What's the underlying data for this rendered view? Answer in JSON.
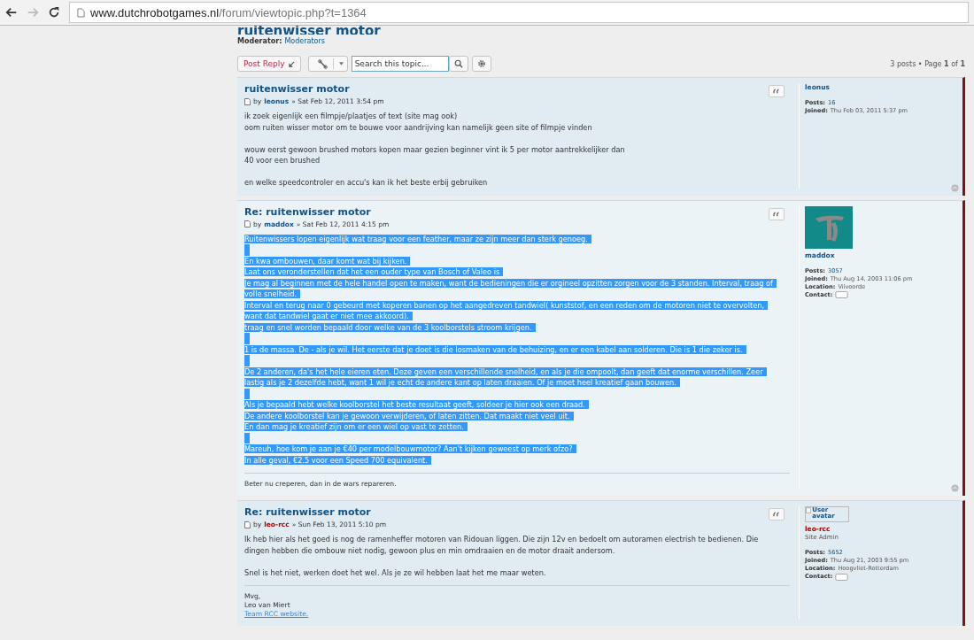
{
  "browser": {
    "url_host": "www.dutchrobotgames.nl",
    "url_path": "/forum/viewtopic.php?t=1364"
  },
  "topic": {
    "title": "ruitenwisser motor",
    "moderator_label": "Moderator:",
    "moderator": "Moderators"
  },
  "toolbar": {
    "post_reply": "Post Reply",
    "search_placeholder": "Search this topic...",
    "pagination": {
      "posts": "3 posts • Page",
      "current": "1",
      "of": "of",
      "total": "1"
    }
  },
  "posts": [
    {
      "title": "ruitenwisser motor",
      "by": "by",
      "author": "leonus",
      "color": "#105289",
      "date": "» Sat Feb 12, 2011 3:54 pm",
      "selected": false,
      "paragraphs": [
        [
          "ik zoek eigenlijk een filmpje/plaatjes of text (site mag ook)",
          "oom ruiten wisser motor om te bouwe voor aandrijving kan namelijk geen site of filmpje vinden"
        ],
        [
          "wouw eerst gewoon brushed motors kopen maar gezien beginner vint ik 5 per motor aantrekkelijker dan",
          "40 voor een brushed"
        ],
        [
          "en welke speedcontroler en accu's kan ik het beste erbij gebruiken"
        ]
      ],
      "profile": {
        "username": "leonus",
        "fields": [
          {
            "label": "Posts:",
            "value": "16",
            "kind": "link"
          },
          {
            "label": "Joined:",
            "value": "Thu Feb 03, 2011 5:37 pm",
            "kind": "text"
          }
        ]
      }
    },
    {
      "title": "Re: ruitenwisser motor",
      "by": "by",
      "author": "maddox",
      "color": "#105289",
      "date": "» Sat Feb 12, 2011 4:15 pm",
      "selected": true,
      "paragraphs": [
        [
          "Ruitenwissers lopen eigenlijk wat traag voor een feather, maar ze zijn meer dan sterk genoeg."
        ],
        [
          "En kwa ombouwen, daar komt wat bij kijken.",
          "Laat ons veronderstellen dat het een ouder type van Bosch of Valeo is",
          "Je mag al beginnen met de hele handel open te maken, want de bedieningen die er orgineel opzitten zorgen voor de 3 standen. Interval, traag of",
          "volle snelheid.",
          "Interval en terug naar 0 gebeurd met koperen banen op het aangedreven tandwiel( kunststof, en een reden om de motoren niet te overvolten,",
          "want dat tandwiel gaat er niet mee akkoord).",
          "traag en snel worden bepaald door welke van de 3 koolborstels stroom krijgen."
        ],
        [
          "1 is de massa. De - als je wil. Het eerste dat je doet is die losmaken van de behuizing, en er een kabel aan solderen. Die is 1 die zeker is."
        ],
        [
          "De 2 anderen, da's het hele eieren eten. Deze geven een verschillende snelheid, en als je die ompoolt, dan geeft dat enorme verschillen. Zeer",
          "lastig als je 2 dezelfde hebt, want 1 wil je echt de andere kant op laten draaien. Of je moet heel kreatief gaan bouwen."
        ],
        [
          "Als je bepaald hebt welke koolborstel het beste resultaat geeft, soldeer je hier ook een draad.",
          "De andere koolborstel kan je gewoon verwijderen, of laten zitten. Dat maakt niet veel uit.",
          "En dan mag je kreatief zijn om er een wiel op vast te zetten."
        ],
        [
          "Mareuh, hoe kom je aan je €40 per modelbouwmotor? Aan't kijken geweest op merk ofzo?",
          "In alle geval, €2.5 voor een Speed 700 equivalent."
        ]
      ],
      "signature": [
        "Beter nu creperen, dan in de wars repareren."
      ],
      "profile": {
        "username": "maddox",
        "fields": [
          {
            "label": "Posts:",
            "value": "3057",
            "kind": "link"
          },
          {
            "label": "Joined:",
            "value": "Thu Aug 14, 2003 11:06 pm",
            "kind": "text"
          },
          {
            "label": "Location:",
            "value": "Vilvoorde",
            "kind": "text"
          },
          {
            "label": "Contact:",
            "kind": "contact"
          }
        ]
      }
    },
    {
      "title": "Re: ruitenwisser motor",
      "by": "by",
      "author": "leo-rcc",
      "color": "#aa0000",
      "date": "» Sun Feb 13, 2011 5:10 pm",
      "selected": false,
      "paragraphs": [
        [
          "Ik heb hier als het goed is nog de ramenheffer motoren van Ridouan liggen. Die zijn 12v en bedoelt om autoramen electrish te bedienen. Die",
          "dingen hebben die ombouw niet nodig, gewoon plus en min omdraaien en de motor draait andersom."
        ],
        [
          "Snel is het niet, werken doet het wel. Als je ze wil hebben laat het me maar weten."
        ]
      ],
      "signature": [
        "Mvg,",
        "Leo van Miert"
      ],
      "link": "Team RCC website.",
      "profile": {
        "avatar": {
          "kind": "broken",
          "alt": "User avatar"
        },
        "username": "leo-rcc",
        "rank": "Site Admin",
        "fields": [
          {
            "label": "Posts:",
            "value": "5652",
            "kind": "link"
          },
          {
            "label": "Joined:",
            "value": "Thu Aug 21, 2003 9:55 pm",
            "kind": "text"
          },
          {
            "label": "Location:",
            "value": "Hoogvliet-Rotterdam",
            "kind": "text"
          },
          {
            "label": "Contact:",
            "kind": "contact"
          }
        ]
      }
    }
  ]
}
